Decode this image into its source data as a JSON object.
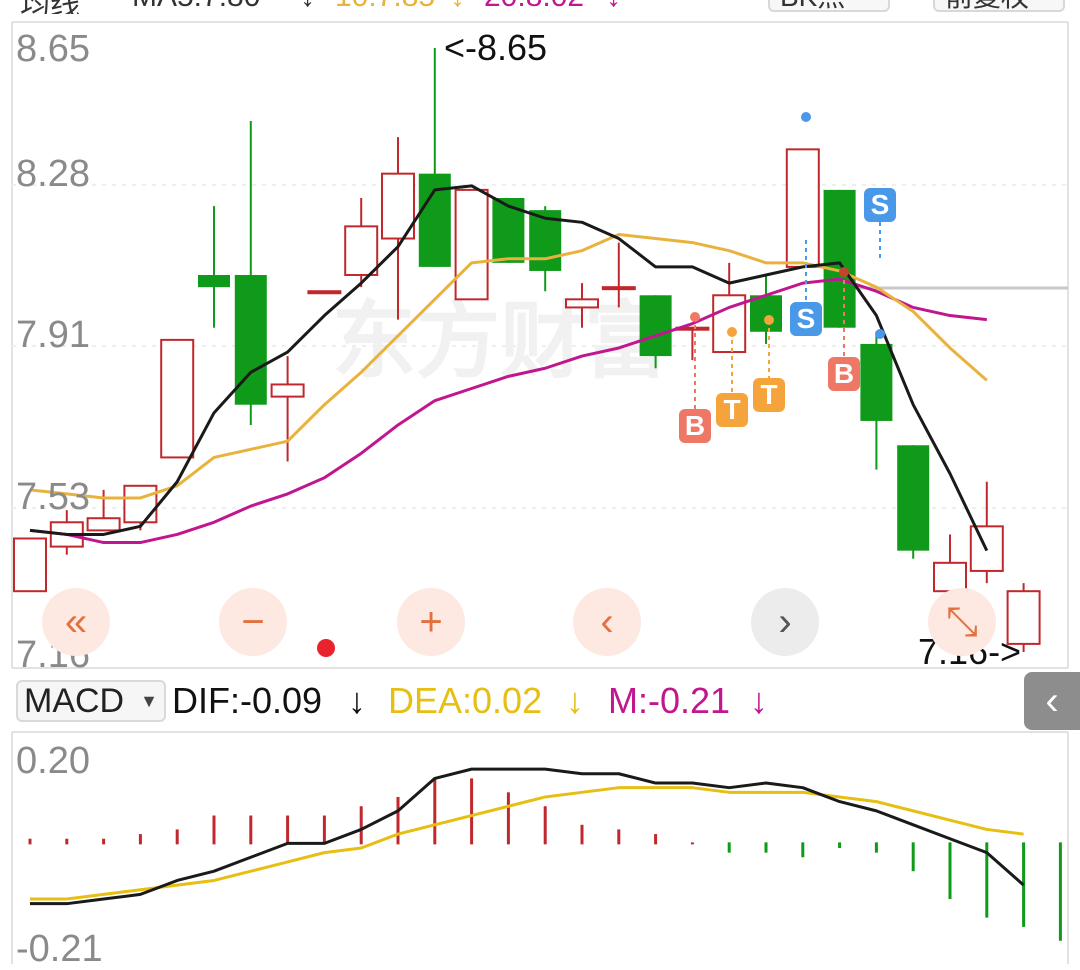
{
  "header": {
    "period_label": "均线",
    "ma5_label": "MA5:7.80",
    "ma5_arrow": "↓",
    "ma10_label": "10:7.85",
    "ma10_arrow": "↓",
    "ma20_label": "20:8.02",
    "ma20_arrow": "↓",
    "chip_button": "BK点",
    "adjust_button": "前复权"
  },
  "price_axis": [
    "8.65",
    "8.28",
    "7.91",
    "7.53",
    "7.16"
  ],
  "annotations": {
    "high": "<-8.65",
    "low": "7.16->"
  },
  "watermark": "东方财富",
  "nav": {
    "first": "«",
    "zoom_out": "−",
    "zoom_in": "+",
    "prev": "‹",
    "next": "›",
    "expand": "⤡"
  },
  "macd": {
    "selector": "MACD",
    "dif": "DIF:-0.09",
    "dif_arrow": "↓",
    "dea": "DEA:0.02",
    "dea_arrow": "↓",
    "m": "M:-0.21",
    "m_arrow": "↓",
    "axis": [
      "0.20",
      "-0.21"
    ]
  },
  "colors": {
    "up": "#c0282d",
    "down": "#0f9a1a",
    "ma5": "#1a1a1a",
    "ma10": "#e9b23c",
    "ma20": "#c0178f",
    "dea": "#e6bf12",
    "signal_b": "#ef7766",
    "signal_t": "#f5a43c",
    "signal_s": "#4a98e8"
  },
  "signals": [
    {
      "text": "B",
      "type": "b"
    },
    {
      "text": "T",
      "type": "t"
    },
    {
      "text": "T",
      "type": "t"
    },
    {
      "text": "S",
      "type": "s"
    },
    {
      "text": "S",
      "type": "s"
    },
    {
      "text": "B",
      "type": "b"
    }
  ],
  "chart_data": {
    "type": "candlestick",
    "y_range": [
      7.16,
      8.65
    ],
    "candles": [
      {
        "o": 7.31,
        "c": 7.44,
        "h": 7.44,
        "l": 7.31
      },
      {
        "o": 7.42,
        "c": 7.48,
        "h": 7.51,
        "l": 7.4
      },
      {
        "o": 7.46,
        "c": 7.49,
        "h": 7.56,
        "l": 7.46
      },
      {
        "o": 7.48,
        "c": 7.57,
        "h": 7.57,
        "l": 7.46
      },
      {
        "o": 7.64,
        "c": 7.93,
        "h": 7.93,
        "l": 7.64
      },
      {
        "o": 8.09,
        "c": 8.06,
        "h": 8.26,
        "l": 7.96
      },
      {
        "o": 8.09,
        "c": 7.77,
        "h": 8.47,
        "l": 7.72
      },
      {
        "o": 7.79,
        "c": 7.82,
        "h": 7.89,
        "l": 7.63
      },
      {
        "o": 8.05,
        "c": 8.05,
        "h": 8.05,
        "l": 8.05
      },
      {
        "o": 8.09,
        "c": 8.21,
        "h": 8.28,
        "l": 8.06
      },
      {
        "o": 8.18,
        "c": 8.34,
        "h": 8.43,
        "l": 7.98
      },
      {
        "o": 8.34,
        "c": 8.11,
        "h": 8.65,
        "l": 8.11
      },
      {
        "o": 8.03,
        "c": 8.3,
        "h": 8.3,
        "l": 8.03
      },
      {
        "o": 8.28,
        "c": 8.12,
        "h": 8.28,
        "l": 8.12
      },
      {
        "o": 8.25,
        "c": 8.1,
        "h": 8.26,
        "l": 8.05
      },
      {
        "o": 8.01,
        "c": 8.03,
        "h": 8.07,
        "l": 7.96
      },
      {
        "o": 8.06,
        "c": 8.06,
        "h": 8.17,
        "l": 8.01
      },
      {
        "o": 8.04,
        "c": 7.89,
        "h": 8.04,
        "l": 7.86
      },
      {
        "o": 7.96,
        "c": 7.96,
        "h": 7.96,
        "l": 7.88
      },
      {
        "o": 7.9,
        "c": 8.04,
        "h": 8.12,
        "l": 7.9
      },
      {
        "o": 8.04,
        "c": 7.95,
        "h": 8.09,
        "l": 7.92
      },
      {
        "o": 8.11,
        "c": 8.4,
        "h": 8.4,
        "l": 8.11
      },
      {
        "o": 8.3,
        "c": 7.96,
        "h": 8.3,
        "l": 7.96
      },
      {
        "o": 7.92,
        "c": 7.73,
        "h": 7.95,
        "l": 7.61
      },
      {
        "o": 7.67,
        "c": 7.41,
        "h": 7.67,
        "l": 7.39
      },
      {
        "o": 7.31,
        "c": 7.38,
        "h": 7.45,
        "l": 7.27
      },
      {
        "o": 7.36,
        "c": 7.47,
        "h": 7.58,
        "l": 7.33
      },
      {
        "o": 7.18,
        "c": 7.31,
        "h": 7.33,
        "l": 7.16
      }
    ],
    "ma5": [
      7.46,
      7.45,
      7.45,
      7.47,
      7.58,
      7.75,
      7.85,
      7.9,
      7.99,
      8.07,
      8.16,
      8.3,
      8.31,
      8.26,
      8.23,
      8.22,
      8.18,
      8.11,
      8.11,
      8.07,
      8.09,
      8.11,
      8.12,
      7.99,
      7.77,
      7.6,
      7.41
    ],
    "ma10": [
      7.56,
      7.55,
      7.54,
      7.54,
      7.57,
      7.64,
      7.66,
      7.68,
      7.77,
      7.85,
      7.94,
      8.03,
      8.12,
      8.13,
      8.13,
      8.15,
      8.19,
      8.18,
      8.17,
      8.15,
      8.12,
      8.12,
      8.1,
      8.06,
      8.0,
      7.91,
      7.83
    ],
    "ma20": [
      7.46,
      7.45,
      7.43,
      7.43,
      7.45,
      7.48,
      7.52,
      7.55,
      7.59,
      7.65,
      7.72,
      7.78,
      7.81,
      7.84,
      7.86,
      7.89,
      7.91,
      7.94,
      7.97,
      8.01,
      8.04,
      8.07,
      8.08,
      8.05,
      8.01,
      7.99,
      7.98
    ],
    "macd": {
      "y_range": [
        -0.26,
        0.24
      ],
      "dif": [
        -0.13,
        -0.13,
        -0.12,
        -0.11,
        -0.08,
        -0.06,
        -0.03,
        -0.0,
        0.0,
        0.03,
        0.07,
        0.14,
        0.16,
        0.16,
        0.16,
        0.15,
        0.15,
        0.13,
        0.13,
        0.12,
        0.13,
        0.12,
        0.09,
        0.07,
        0.04,
        0.01,
        -0.02,
        -0.09
      ],
      "dea": [
        -0.12,
        -0.12,
        -0.11,
        -0.1,
        -0.09,
        -0.08,
        -0.06,
        -0.04,
        -0.02,
        -0.01,
        0.02,
        0.04,
        0.06,
        0.08,
        0.1,
        0.11,
        0.12,
        0.12,
        0.12,
        0.11,
        0.11,
        0.11,
        0.1,
        0.09,
        0.07,
        0.05,
        0.03,
        0.02
      ],
      "m": [
        0.01,
        0.01,
        0.01,
        0.02,
        0.03,
        0.06,
        0.06,
        0.06,
        0.06,
        0.08,
        0.1,
        0.14,
        0.14,
        0.11,
        0.08,
        0.04,
        0.03,
        0.02,
        0.0,
        -0.02,
        -0.02,
        -0.03,
        -0.01,
        -0.02,
        -0.06,
        -0.12,
        -0.16,
        -0.18,
        -0.21
      ]
    }
  }
}
